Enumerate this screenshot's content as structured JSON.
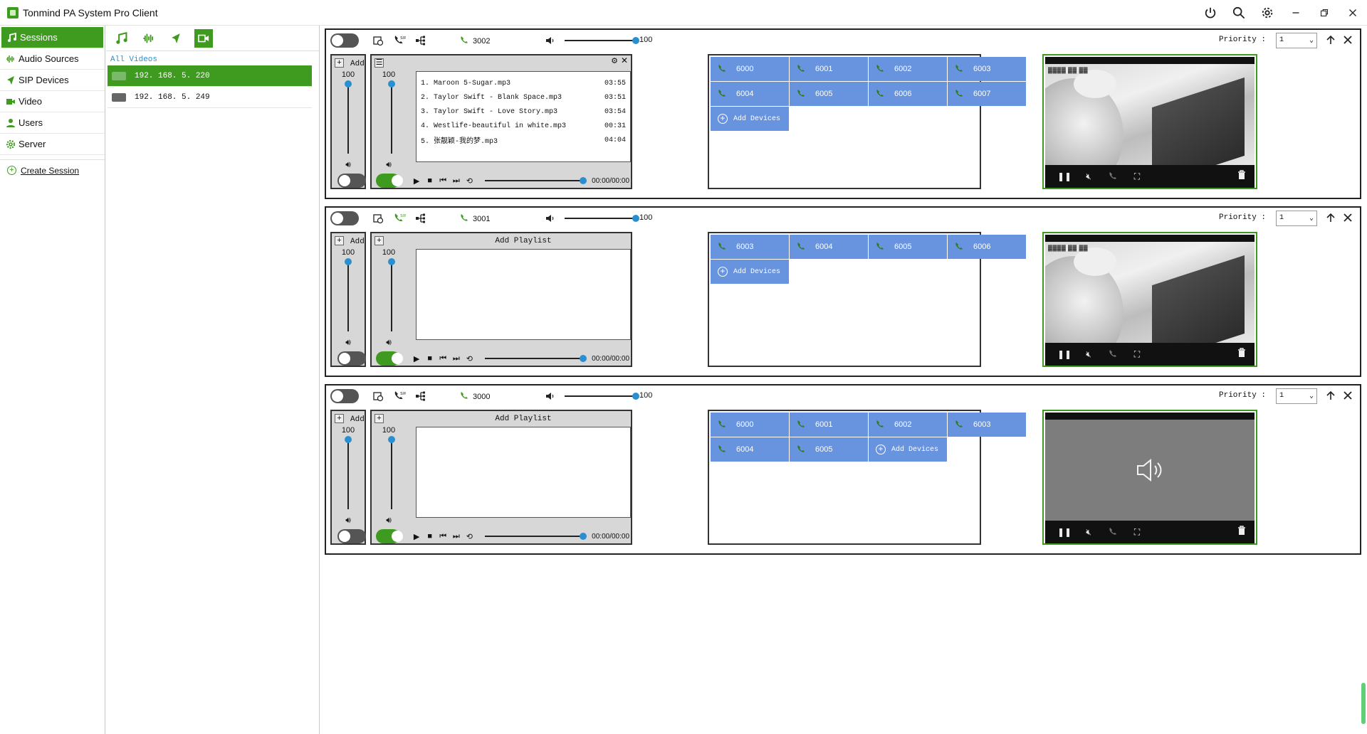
{
  "app": {
    "title": "Tonmind PA System Pro Client",
    "brand_color": "#3f9b20"
  },
  "titlebar_icons": [
    "power-icon",
    "search-icon",
    "gear-icon",
    "minimize-icon",
    "restore-icon",
    "close-icon"
  ],
  "sidebar": {
    "items": [
      {
        "label": "Sessions",
        "icon": "music-note-icon",
        "active": true
      },
      {
        "label": "Audio Sources",
        "icon": "waveform-icon",
        "active": false
      },
      {
        "label": "SIP Devices",
        "icon": "send-arrow-icon",
        "active": false
      },
      {
        "label": "Video",
        "icon": "video-camera-icon",
        "active": false
      },
      {
        "label": "Users",
        "icon": "user-icon",
        "active": false
      },
      {
        "label": "Server",
        "icon": "gear-icon",
        "active": false
      }
    ],
    "create_label": "Create Session"
  },
  "video_panel": {
    "filter_label": "All Videos",
    "cameras": [
      {
        "ip": "192. 168. 5. 220",
        "selected": true
      },
      {
        "ip": "192. 168. 5. 249",
        "selected": false
      }
    ]
  },
  "sessions": [
    {
      "extension": "3002",
      "volume": "100",
      "priority_label": "Priority :",
      "priority": "1",
      "add_label": "Add",
      "mic_volume": "100",
      "playlist_volume": "100",
      "playlist_title": "",
      "songs": [
        {
          "name": "1. Maroon 5-Sugar.mp3",
          "duration": "03:55"
        },
        {
          "name": "2. Taylor Swift - Blank Space.mp3",
          "duration": "03:51"
        },
        {
          "name": "3. Taylor Swift - Love Story.mp3",
          "duration": "03:54"
        },
        {
          "name": "4. Westlife-beautiful in white.mp3",
          "duration": "00:31"
        },
        {
          "name": "5. 张靓颖-我的梦.mp3",
          "duration": "04:04"
        }
      ],
      "time": "00:00/00:00",
      "devices": [
        "6000",
        "6001",
        "6002",
        "6003",
        "6004",
        "6005",
        "6006",
        "6007"
      ],
      "add_devices_label": "Add Devices",
      "video_mode": "camera"
    },
    {
      "extension": "3001",
      "volume": "100",
      "priority_label": "Priority :",
      "priority": "1",
      "add_label": "Add",
      "mic_volume": "100",
      "playlist_volume": "100",
      "playlist_title": "Add Playlist",
      "songs": [],
      "time": "00:00/00:00",
      "devices": [
        "6003",
        "6004",
        "6005",
        "6006"
      ],
      "add_devices_label": "Add Devices",
      "video_mode": "camera"
    },
    {
      "extension": "3000",
      "volume": "100",
      "priority_label": "Priority :",
      "priority": "1",
      "add_label": "Add",
      "mic_volume": "100",
      "playlist_volume": "100",
      "playlist_title": "Add Playlist",
      "songs": [],
      "time": "00:00/00:00",
      "devices": [
        "6000",
        "6001",
        "6002",
        "6003",
        "6004",
        "6005"
      ],
      "add_devices_label": "Add Devices",
      "video_mode": "audio"
    }
  ],
  "colors": {
    "device_tile": "#6893de",
    "slider_knob": "#2a8fd0",
    "video_border": "#3f9b20"
  }
}
